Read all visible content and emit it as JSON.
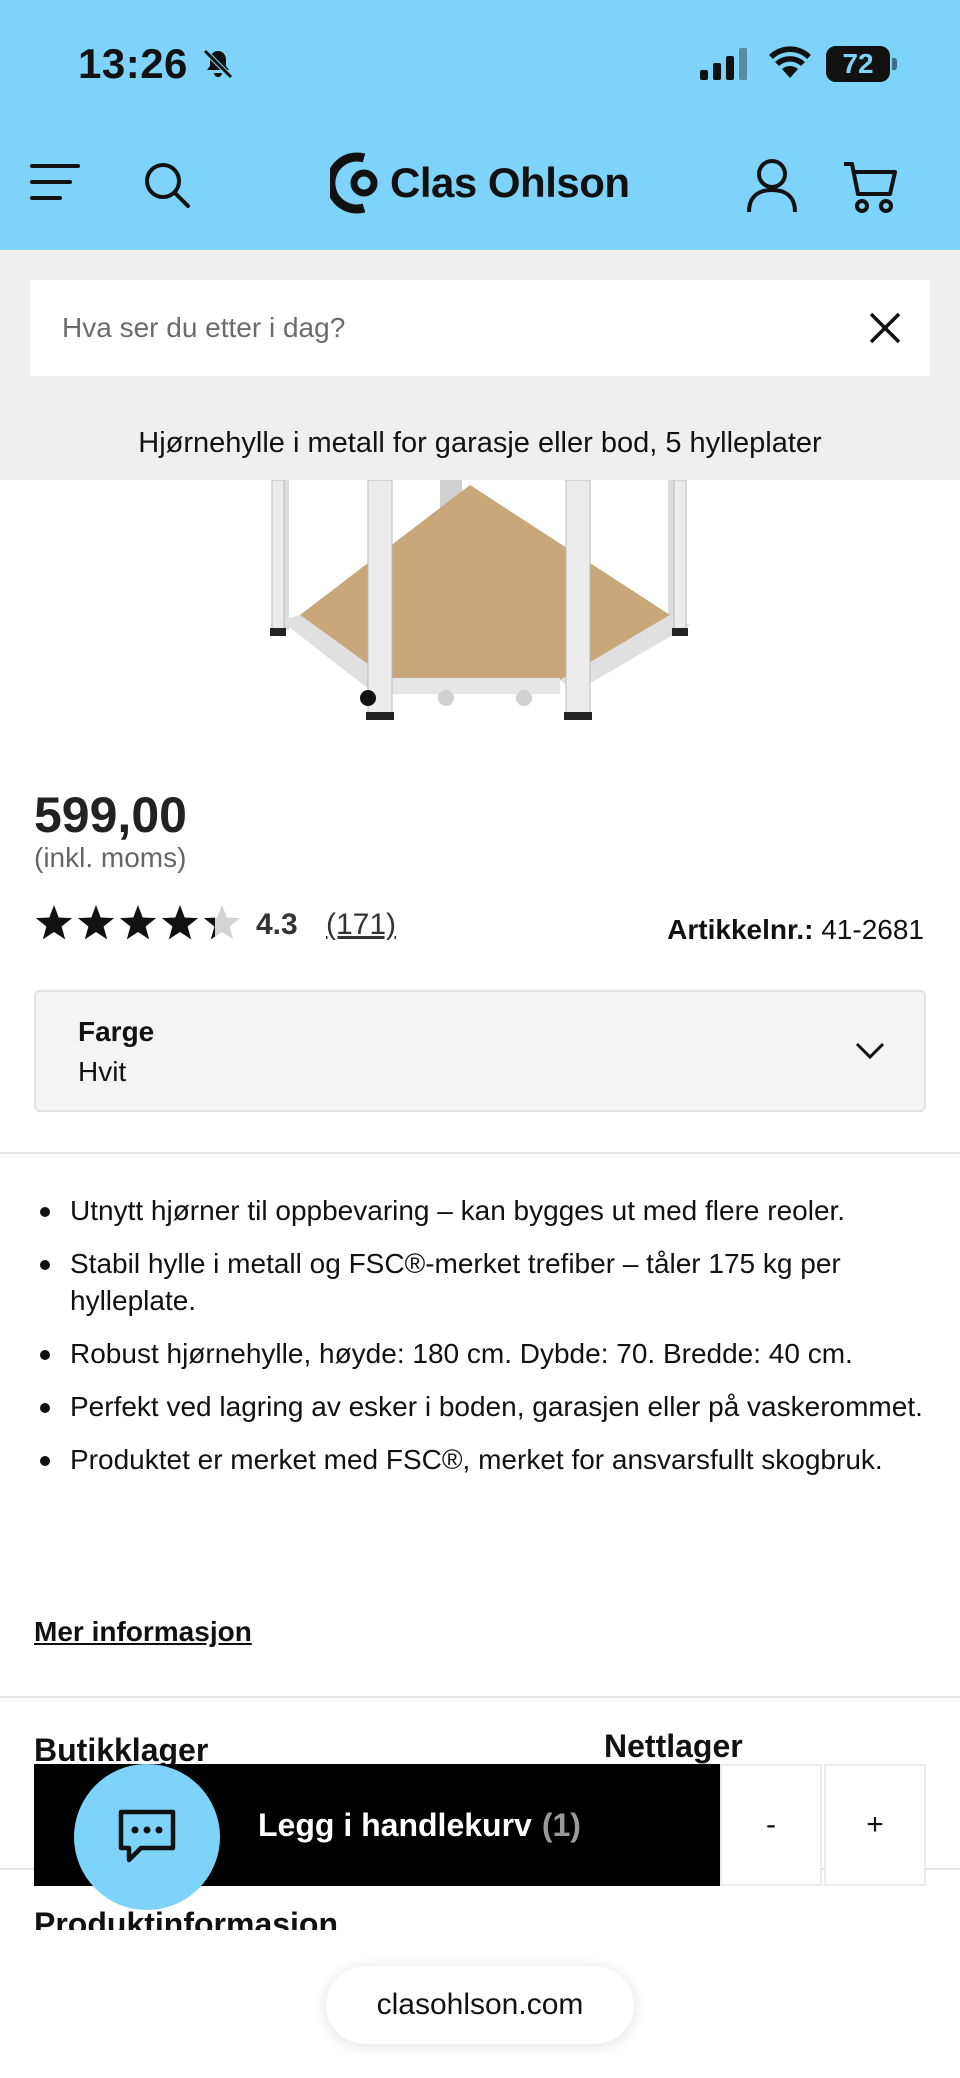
{
  "status_bar": {
    "time": "13:26",
    "battery": "72",
    "battery_level": 0.72
  },
  "header": {
    "brand": "Clas Ohlson",
    "icons": [
      "menu-icon",
      "search-icon",
      "account-icon",
      "cart-icon"
    ]
  },
  "search": {
    "placeholder": "Hva ser du etter i dag?",
    "value": ""
  },
  "product": {
    "title": "Hjørnehylle i metall for garasje eller bod, 5 hylleplater",
    "price": "599,00",
    "vat_note": "(inkl. moms)",
    "rating": {
      "value": "4.3",
      "count": "(171)",
      "stars": 4.3
    },
    "article_label": "Artikkelnr.:",
    "article_number": "41-2681",
    "carousel": {
      "count": 3,
      "active": 0
    },
    "color": {
      "label": "Farge",
      "value": "Hvit"
    },
    "highlights": [
      "Utnytt hjørner til oppbevaring – kan bygges ut med flere reoler.",
      "Stabil hylle i metall og FSC®-merket trefiber – tåler 175 kg per hylleplate.",
      "Robust hjørnehylle, høyde: 180 cm. Dybde: 70. Bredde: 40 cm.",
      "Perfekt ved lagring av esker i boden, garasjen eller på vaskerommet.",
      "Produktet er merket med FSC®, merket for ansvarsfullt skogbruk."
    ],
    "more_info": "Mer informasjon",
    "stock": {
      "store": "Butikklager",
      "online": "Nettlager"
    },
    "product_info_heading": "Produktinformasjon"
  },
  "cart_bar": {
    "add_label": "Legg i handlekurv",
    "quantity": "(1)",
    "minus": "-",
    "plus": "+"
  },
  "browser": {
    "url": "clasohlson.com"
  },
  "colors": {
    "header_bg": "#7dd3f9",
    "cta": "#000000",
    "panel": "#efefef"
  }
}
